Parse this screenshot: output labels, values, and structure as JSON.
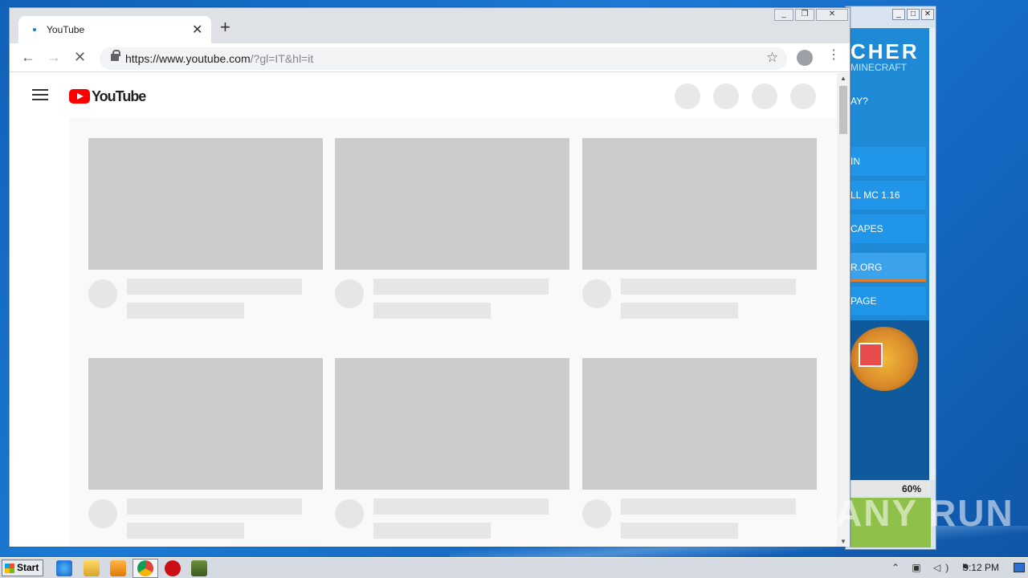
{
  "browser": {
    "tab_title": "YouTube",
    "url_host": "https://www.youtube.com",
    "url_rest": "/?gl=IT&hl=it",
    "nav_back": "←",
    "nav_forward": "→",
    "nav_stop": "✕",
    "new_tab": "+",
    "tab_close": "✕",
    "star": "☆",
    "menu": "⋮"
  },
  "youtube": {
    "logo_text": "YouTube",
    "cards": [
      {
        "id": 1
      },
      {
        "id": 2
      },
      {
        "id": 3
      },
      {
        "id": 4
      },
      {
        "id": 5
      },
      {
        "id": 6
      }
    ]
  },
  "launcher": {
    "title": "CHER",
    "subtitle": "MINECRAFT",
    "question": "AY?",
    "items": [
      "IN",
      "LL MC 1.16",
      "CAPES",
      "R.ORG",
      "PAGE"
    ],
    "progress": "60%"
  },
  "taskbar": {
    "start_label": "Start",
    "clock": "9:12 PM"
  },
  "watermark": "ANY RUN",
  "colors": {
    "youtube_red": "#ff0000",
    "chrome_blue": "#1a73e8",
    "skeleton_thumb": "#cccccc",
    "skeleton_line": "#e6e6e6"
  }
}
